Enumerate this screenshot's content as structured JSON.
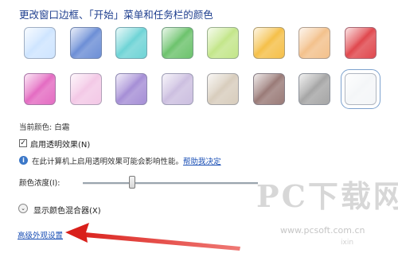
{
  "heading": "更改窗口边框、「开始」菜单和任务栏的颜色",
  "swatches": [
    {
      "name": "sky",
      "color": "#cfe5ff"
    },
    {
      "name": "twilight",
      "color": "#6d8fd6"
    },
    {
      "name": "sea",
      "color": "#6fd4d6"
    },
    {
      "name": "leaf",
      "color": "#6dc36d"
    },
    {
      "name": "lime",
      "color": "#c3e68a"
    },
    {
      "name": "pumpkin",
      "color": "#f5c04a"
    },
    {
      "name": "tangerine",
      "color": "#f3c18c"
    },
    {
      "name": "ruby",
      "color": "#e0484e"
    },
    {
      "name": "fuchsia",
      "color": "#e46cc2"
    },
    {
      "name": "blush",
      "color": "#f3c8e6"
    },
    {
      "name": "violet",
      "color": "#a68fd6"
    },
    {
      "name": "lavender",
      "color": "#ccbfe0"
    },
    {
      "name": "taupe",
      "color": "#d8cdbd"
    },
    {
      "name": "chocolate",
      "color": "#9a7b78"
    },
    {
      "name": "slate",
      "color": "#a6a6a6"
    },
    {
      "name": "frost",
      "color": "#f4f6f8"
    }
  ],
  "current_color": {
    "label": "当前颜色: 白霜"
  },
  "transparency": {
    "label": "启用透明效果(N)",
    "checked": true,
    "check_glyph": "✓"
  },
  "info": {
    "icon": "i",
    "text": "在此计算机上启用透明效果可能会影响性能。",
    "link": "帮助我决定"
  },
  "intensity": {
    "label": "颜色浓度(I):",
    "value_fraction": 0.28
  },
  "mixer": {
    "label": "显示颜色混合器(X)",
    "glyph": "⌄"
  },
  "advanced_link": "高级外观设置",
  "watermark": {
    "text": "PC下载网",
    "url": "www.pcsoft.com.cn",
    "sub": "ixin"
  },
  "colors": {
    "link": "#1a4fb5",
    "heading": "#1f3f8f",
    "arrow": "#d9201b"
  }
}
